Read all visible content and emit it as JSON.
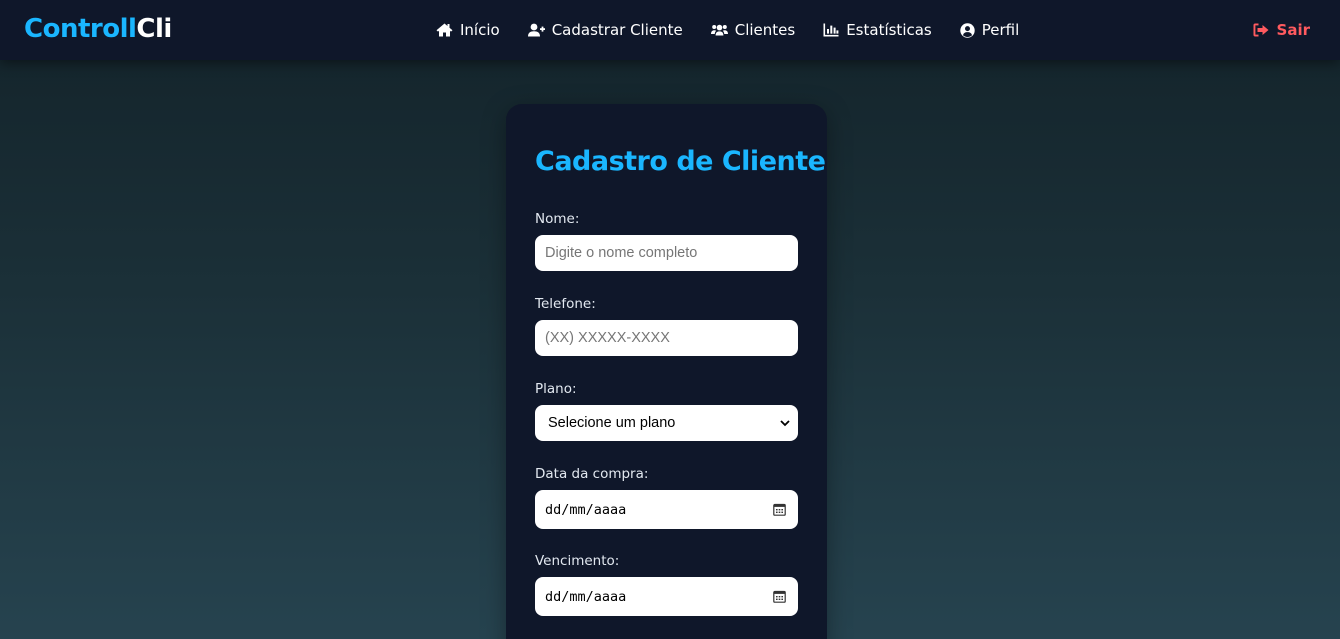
{
  "nav": {
    "brand_part1": "Controll",
    "brand_part2": "Cli",
    "links": [
      {
        "label": "Início",
        "icon": "home-icon"
      },
      {
        "label": "Cadastrar Cliente",
        "icon": "user-plus-icon"
      },
      {
        "label": "Clientes",
        "icon": "users-icon"
      },
      {
        "label": "Estatísticas",
        "icon": "chart-bar-icon"
      },
      {
        "label": "Perfil",
        "icon": "user-circle-icon"
      }
    ],
    "logout_label": "Sair",
    "logout_icon": "sign-out-icon"
  },
  "form": {
    "title": "Cadastro de Cliente",
    "name_label": "Nome:",
    "name_placeholder": "Digite o nome completo",
    "phone_label": "Telefone:",
    "phone_placeholder": "(XX) XXXXX-XXXX",
    "plan_label": "Plano:",
    "plan_selected": "Selecione um plano",
    "purchase_date_label": "Data da compra:",
    "purchase_date_value": "dd/mm/aaaa",
    "due_date_label": "Vencimento:",
    "due_date_value": "dd/mm/aaaa"
  },
  "colors": {
    "accent": "#1ab6ff",
    "navbar_bg": "#0f172a",
    "logout": "#ff5a5f"
  }
}
